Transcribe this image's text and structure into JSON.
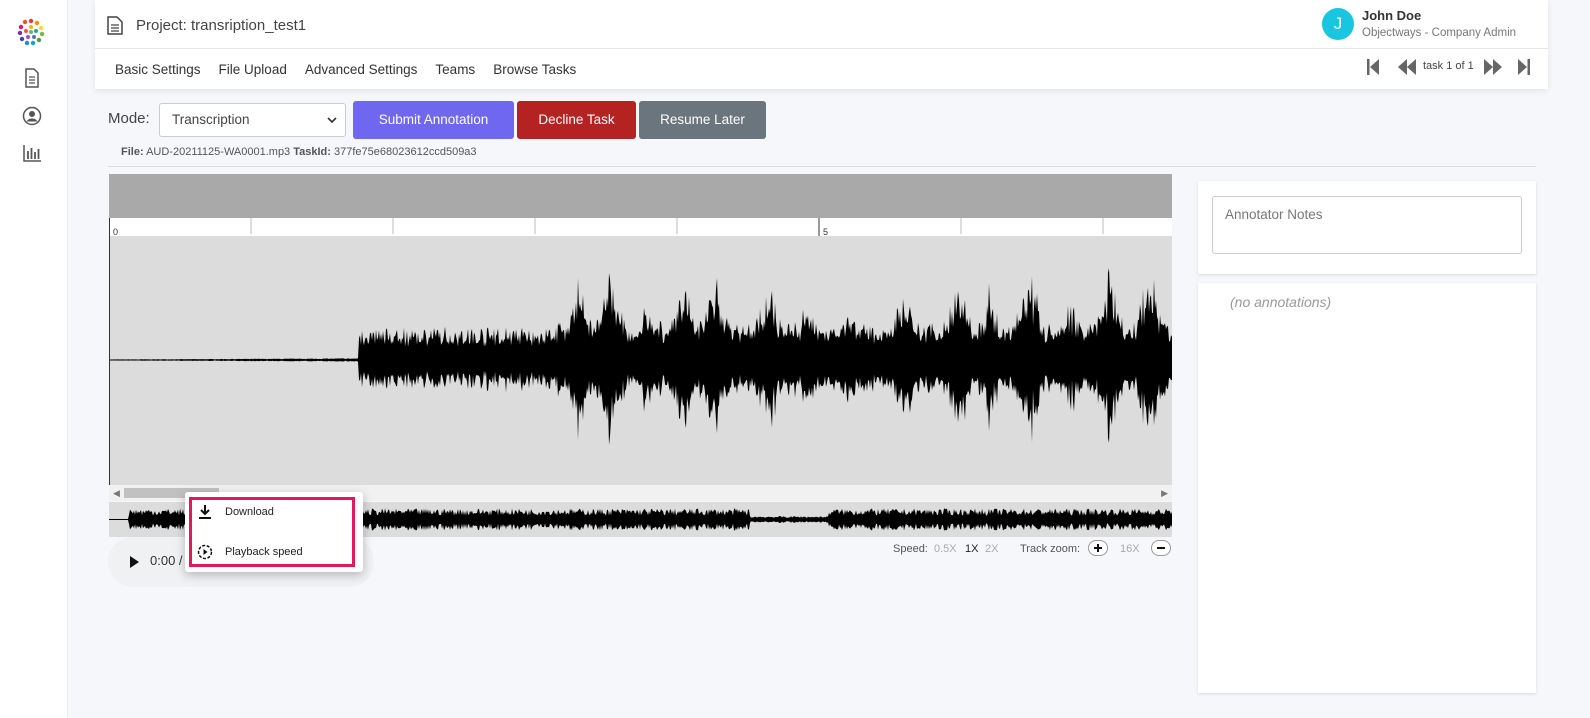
{
  "project": {
    "title": "Project: transription_test1"
  },
  "user": {
    "initial": "J",
    "name": "John Doe",
    "role": "Objectways - Company Admin"
  },
  "nav": {
    "items": [
      "Basic Settings",
      "File Upload",
      "Advanced Settings",
      "Teams",
      "Browse Tasks"
    ]
  },
  "pager": {
    "label": "task 1 of 1"
  },
  "toolbar": {
    "mode_label": "Mode:",
    "mode_value": "Transcription",
    "submit_label": "Submit Annotation",
    "decline_label": "Decline Task",
    "resume_label": "Resume Later"
  },
  "file_info": {
    "file_label": "File:",
    "file_name": "AUD-20211125-WA0001.mp3",
    "task_label": "TaskId:",
    "task_id": "377fe75e68023612ccd509a3"
  },
  "timeline": {
    "marks": [
      "0",
      "5"
    ]
  },
  "player": {
    "time": "0:00 /"
  },
  "popup_menu": {
    "items": [
      {
        "label": "Download",
        "icon": "download-icon"
      },
      {
        "label": "Playback speed",
        "icon": "playback-speed-icon"
      }
    ]
  },
  "speed": {
    "label": "Speed:",
    "options": [
      "0.5X",
      "1X",
      "2X"
    ],
    "selected": "1X"
  },
  "zoom": {
    "label": "Track zoom:",
    "value": "16X"
  },
  "notes": {
    "placeholder": "Annotator Notes"
  },
  "annotations": {
    "empty_text": "(no annotations)"
  },
  "colors": {
    "accent": "#6f67f0",
    "danger": "#b42222",
    "secondary": "#6b757d",
    "avatar": "#18c6e0",
    "highlight": "#e2185b"
  }
}
